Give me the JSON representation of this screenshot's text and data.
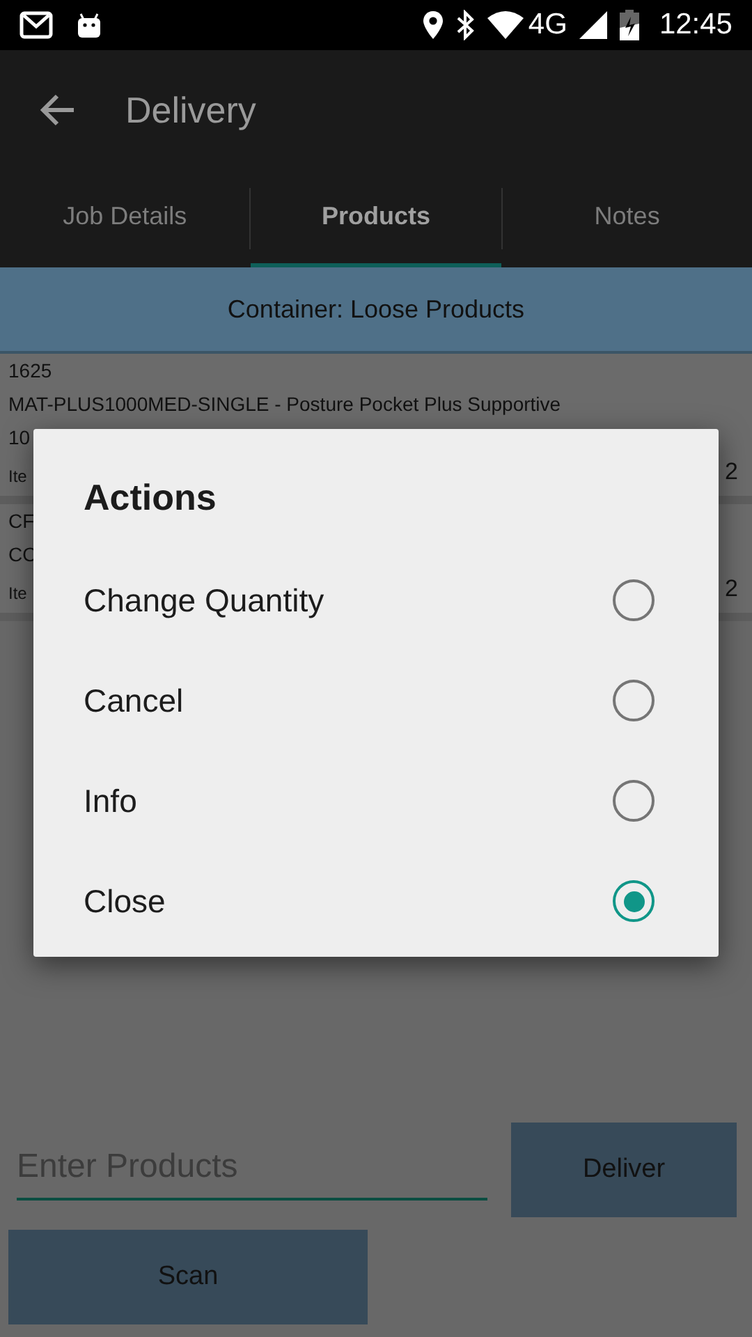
{
  "status_bar": {
    "network": "4G",
    "time": "12:45"
  },
  "toolbar": {
    "title": "Delivery"
  },
  "tabs": [
    {
      "label": "Job Details",
      "selected": false
    },
    {
      "label": "Products",
      "selected": true
    },
    {
      "label": "Notes",
      "selected": false
    }
  ],
  "container_header": "Container: Loose Products",
  "products": [
    {
      "lines": [
        "1625",
        "MAT-PLUS1000MED-SINGLE - Posture Pocket Plus Supportive",
        "10"
      ],
      "item_label": "Ite",
      "quantity": "2"
    },
    {
      "lines": [
        "CF",
        "CO"
      ],
      "item_label": "Ite",
      "quantity": "2"
    }
  ],
  "entry": {
    "placeholder": "Enter Products"
  },
  "buttons": {
    "deliver": "Deliver",
    "scan": "Scan"
  },
  "dialog": {
    "title": "Actions",
    "options": [
      {
        "label": "Change Quantity",
        "selected": false
      },
      {
        "label": "Cancel",
        "selected": false
      },
      {
        "label": "Info",
        "selected": false
      },
      {
        "label": "Close",
        "selected": true
      }
    ]
  }
}
